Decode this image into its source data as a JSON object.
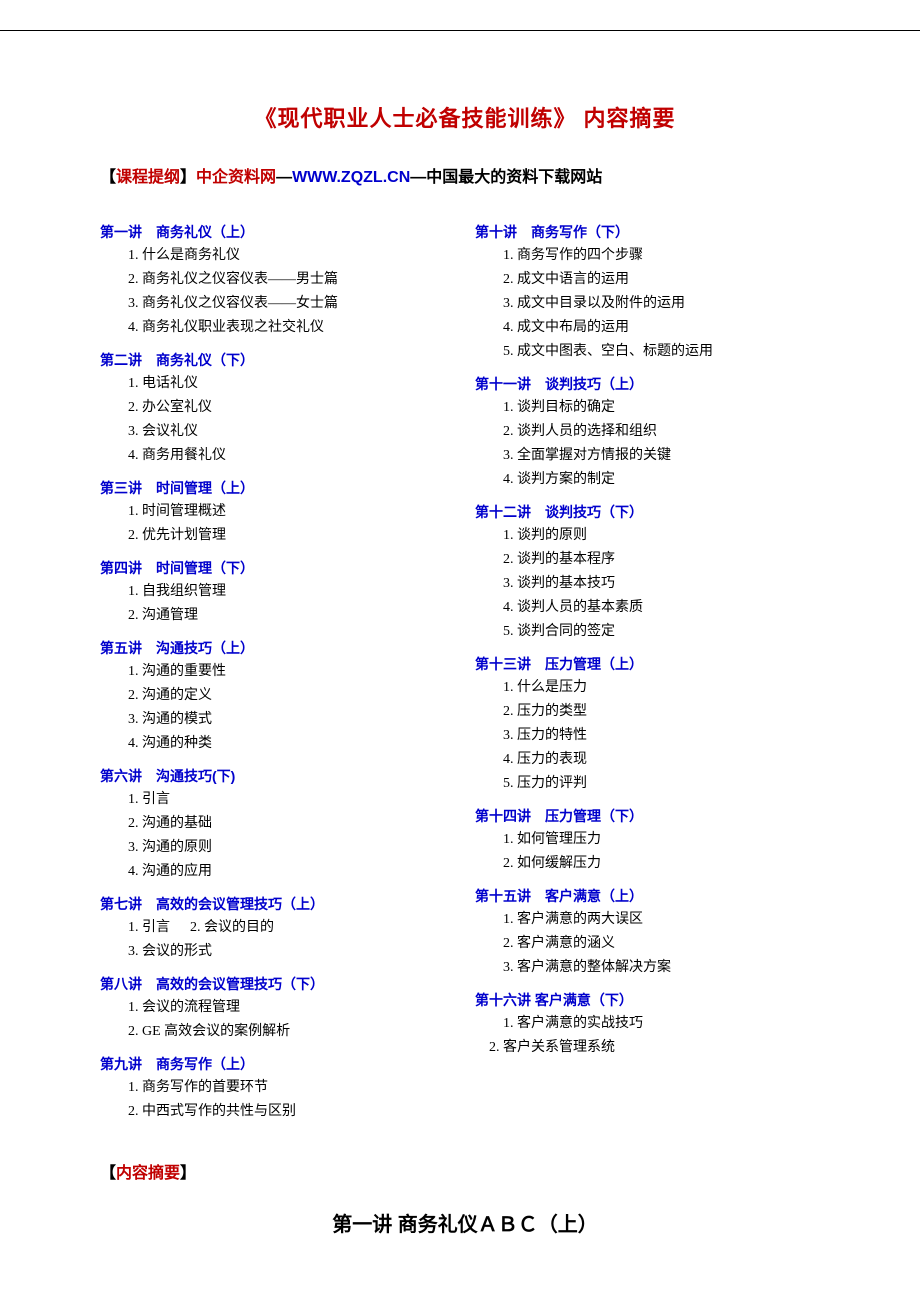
{
  "title": "《现代职业人士必备技能训练》  内容摘要",
  "header": {
    "bracket_open": "【",
    "bracket_label": "课程提纲",
    "bracket_close": "】",
    "red1": "中企资料网",
    "black_dash1": "—",
    "blue_url": "WWW.ZQZL.CN",
    "black_dash2": "—",
    "black_tail": "中国最大的资料下载网站"
  },
  "left": [
    {
      "title": "第一讲　商务礼仪（上）",
      "items": [
        "1. 什么是商务礼仪",
        "2. 商务礼仪之仪容仪表——男士篇",
        "3. 商务礼仪之仪容仪表——女士篇",
        "4. 商务礼仪职业表现之社交礼仪"
      ]
    },
    {
      "title": "第二讲　商务礼仪（下）",
      "items": [
        "1. 电话礼仪",
        "2. 办公室礼仪",
        "3. 会议礼仪",
        "4. 商务用餐礼仪"
      ]
    },
    {
      "title": "第三讲　时间管理（上）",
      "items": [
        "1. 时间管理概述",
        "2. 优先计划管理"
      ]
    },
    {
      "title": "第四讲　时间管理（下）",
      "items": [
        "1. 自我组织管理",
        "2. 沟通管理"
      ]
    },
    {
      "title": "第五讲　沟通技巧（上）",
      "items": [
        "1. 沟通的重要性",
        "2. 沟通的定义",
        "3. 沟通的模式",
        "4. 沟通的种类"
      ]
    },
    {
      "title": "第六讲　沟通技巧(下)",
      "items": [
        "1. 引言",
        "2. 沟通的基础",
        "3. 沟通的原则",
        "4. 沟通的应用"
      ]
    },
    {
      "title": "第七讲　高效的会议管理技巧（上）",
      "inline": [
        "1. 引言",
        "2. 会议的目的"
      ],
      "items": [
        "3. 会议的形式"
      ]
    },
    {
      "title": "第八讲　高效的会议管理技巧（下）",
      "items": [
        "1. 会议的流程管理",
        "2. GE 高效会议的案例解析"
      ]
    },
    {
      "title": "第九讲　商务写作（上）",
      "items": [
        "1. 商务写作的首要环节",
        "2. 中西式写作的共性与区别"
      ]
    }
  ],
  "right": [
    {
      "title": "第十讲　商务写作（下）",
      "items": [
        "1. 商务写作的四个步骤",
        "2. 成文中语言的运用",
        "3. 成文中目录以及附件的运用",
        "4. 成文中布局的运用",
        "5. 成文中图表、空白、标题的运用"
      ]
    },
    {
      "title": "第十一讲　谈判技巧（上）",
      "items": [
        "1. 谈判目标的确定",
        "2. 谈判人员的选择和组织",
        "3. 全面掌握对方情报的关键",
        "4. 谈判方案的制定"
      ]
    },
    {
      "title": "第十二讲　谈判技巧（下）",
      "items": [
        "1. 谈判的原则",
        "2. 谈判的基本程序",
        "3. 谈判的基本技巧",
        "4. 谈判人员的基本素质",
        "5. 谈判合同的签定"
      ]
    },
    {
      "title": "第十三讲　压力管理（上）",
      "items": [
        "1. 什么是压力",
        "2. 压力的类型",
        "3. 压力的特性",
        "4. 压力的表现",
        "5. 压力的评判"
      ]
    },
    {
      "title": "第十四讲　压力管理（下）",
      "items": [
        "1. 如何管理压力",
        "2. 如何缓解压力"
      ]
    },
    {
      "title": "第十五讲　客户满意（上）",
      "items": [
        "1. 客户满意的两大误区",
        "2. 客户满意的涵义",
        "3. 客户满意的整体解决方案"
      ]
    },
    {
      "title": "第十六讲 客户满意（下）",
      "items": [
        "1. 客户满意的实战技巧",
        "2. 客户关系管理系统"
      ],
      "offset_last": true
    }
  ],
  "footer": {
    "bracket_open": "【",
    "bracket_label": "内容摘要",
    "bracket_close": "】"
  },
  "chapter": "第一讲 商务礼仪ＡＢＣ（上）"
}
